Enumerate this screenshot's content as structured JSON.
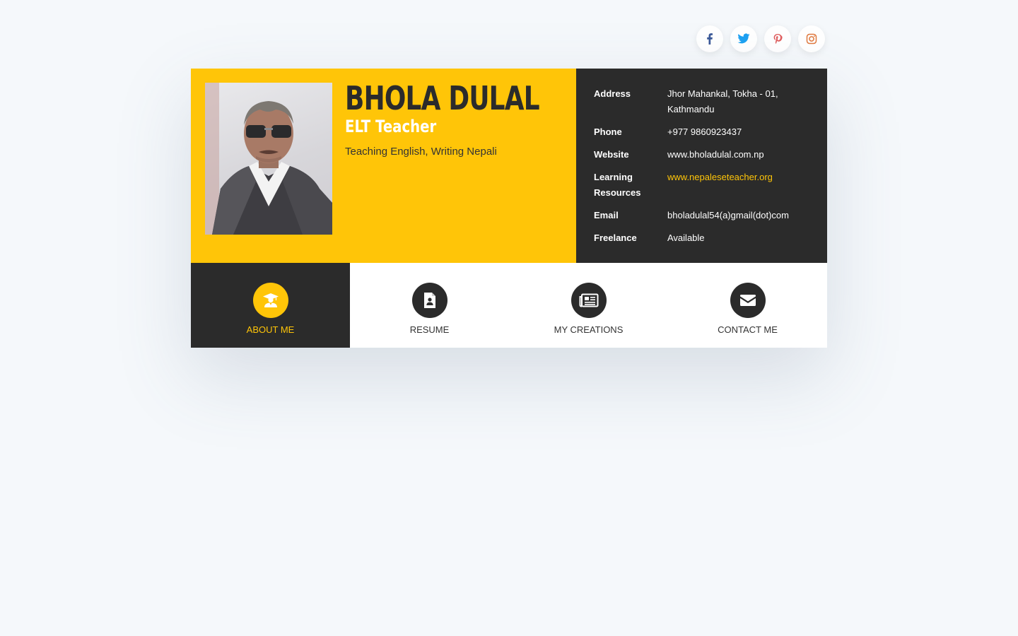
{
  "social": [
    {
      "name": "facebook-icon",
      "color": "#3b5998"
    },
    {
      "name": "twitter-icon",
      "color": "#1da1f2"
    },
    {
      "name": "pinterest-icon",
      "color": "#e05d5d"
    },
    {
      "name": "instagram-icon",
      "color": "#e07a3f"
    }
  ],
  "profile": {
    "name": "BHOLA DULAL",
    "role": "ELT Teacher",
    "tagline": "Teaching English, Writing Nepali"
  },
  "info": {
    "address_label": "Address",
    "address_value": "Jhor Mahankal, Tokha - 01, Kathmandu",
    "phone_label": "Phone",
    "phone_value": "+977 9860923437",
    "website_label": "Website",
    "website_value": "www.bholadulal.com.np",
    "resources_label": "Learning Resources",
    "resources_value": "www.nepaleseteacher.org",
    "email_label": "Email",
    "email_value": "bholadulal54(a)gmail(dot)com",
    "freelance_label": "Freelance",
    "freelance_value": "Available"
  },
  "nav": {
    "about": "ABOUT ME",
    "resume": "RESUME",
    "creations": "MY CREATIONS",
    "contact": "CONTACT ME"
  },
  "colors": {
    "accent": "#ffc508",
    "dark": "#2b2b2b",
    "background": "#f5f8fb"
  }
}
